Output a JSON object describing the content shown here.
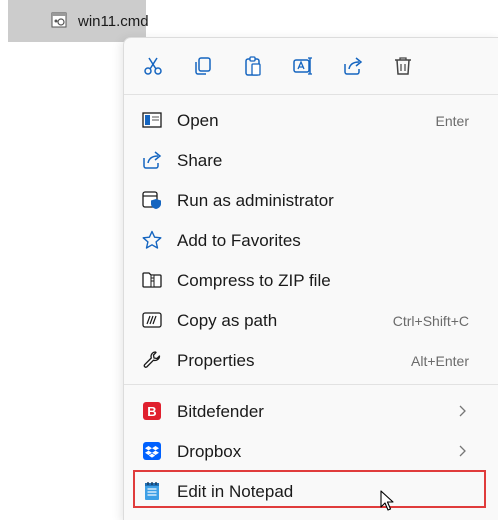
{
  "file": {
    "name": "win11.cmd",
    "icon": "cmd-file-icon"
  },
  "toolbar": [
    {
      "id": "cut",
      "icon": "scissors-icon"
    },
    {
      "id": "copy",
      "icon": "copy-icon"
    },
    {
      "id": "paste",
      "icon": "clipboard-icon"
    },
    {
      "id": "rename",
      "icon": "rename-icon"
    },
    {
      "id": "share",
      "icon": "share-icon"
    },
    {
      "id": "delete",
      "icon": "trash-icon"
    }
  ],
  "menu": {
    "items": [
      {
        "label": "Open",
        "shortcut": "Enter",
        "icon": "open-window-icon"
      },
      {
        "label": "Share",
        "shortcut": "",
        "icon": "share-icon"
      },
      {
        "label": "Run as administrator",
        "shortcut": "",
        "icon": "shield-icon"
      },
      {
        "label": "Add to Favorites",
        "shortcut": "",
        "icon": "star-icon"
      },
      {
        "label": "Compress to ZIP file",
        "shortcut": "",
        "icon": "zip-folder-icon"
      },
      {
        "label": "Copy as path",
        "shortcut": "Ctrl+Shift+C",
        "icon": "copy-path-icon"
      },
      {
        "label": "Properties",
        "shortcut": "Alt+Enter",
        "icon": "wrench-icon"
      }
    ],
    "extensions": [
      {
        "label": "Bitdefender",
        "icon": "bitdefender-icon",
        "icon_letter": "B",
        "has_submenu": true
      },
      {
        "label": "Dropbox",
        "icon": "dropbox-icon",
        "has_submenu": true
      },
      {
        "label": "Edit in Notepad",
        "icon": "notepad-icon",
        "has_submenu": false
      }
    ]
  },
  "colors": {
    "accent": "#1565c0",
    "highlight_border": "#e03c3c",
    "bitdefender": "#e0202e",
    "dropbox": "#0061fe"
  }
}
